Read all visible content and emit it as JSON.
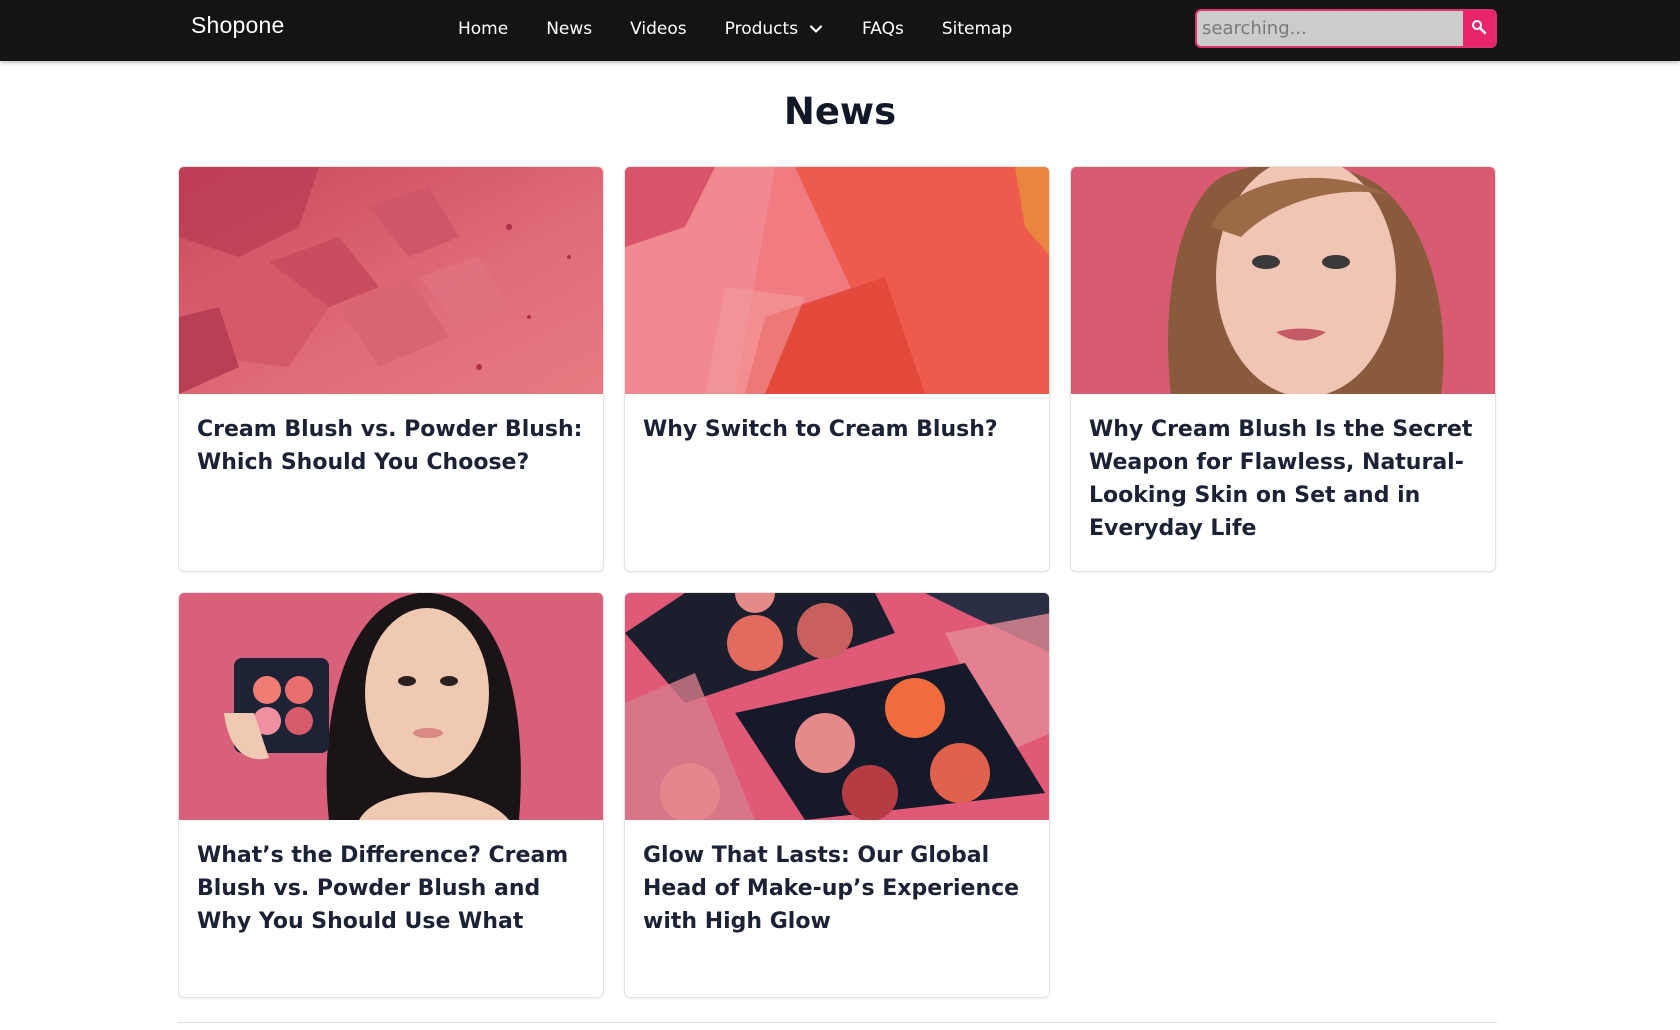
{
  "header": {
    "brand": "Shopone",
    "nav": [
      {
        "label": "Home"
      },
      {
        "label": "News"
      },
      {
        "label": "Videos"
      },
      {
        "label": "Products",
        "has_dropdown": true
      },
      {
        "label": "FAQs"
      },
      {
        "label": "Sitemap"
      }
    ],
    "search": {
      "placeholder": "searching...",
      "value": "",
      "button_icon": "search-icon"
    }
  },
  "main": {
    "title": "News",
    "articles": [
      {
        "title": "Cream Blush vs. Powder Blush: Which Should You Choose?",
        "image": "crushed-pink-blush-powder"
      },
      {
        "title": "Why Switch to Cream Blush?",
        "image": "pink-and-coral-blush-swatches"
      },
      {
        "title": "Why Cream Blush Is the Secret Weapon for Flawless, Natural-Looking Skin on Set and in Everyday Life",
        "image": "woman-portrait-pink-background"
      },
      {
        "title": "What’s the Difference? Cream Blush vs. Powder Blush and Why You Should Use What",
        "image": "woman-holding-blush-palette"
      },
      {
        "title": "Glow That Lasts: Our Global Head of Make-up’s Experience with High Glow",
        "image": "blush-palettes-closeup"
      }
    ]
  },
  "colors": {
    "topbar": "#141414",
    "accent": "#e8246b",
    "heading": "#111827"
  }
}
